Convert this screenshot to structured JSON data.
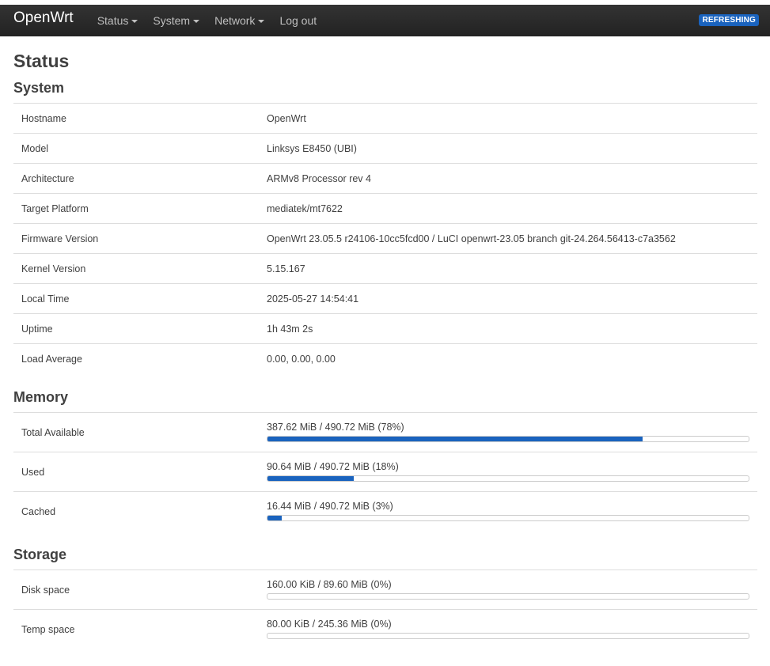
{
  "navbar": {
    "brand": "OpenWrt",
    "menu": [
      {
        "label": "Status",
        "dropdown": true
      },
      {
        "label": "System",
        "dropdown": true
      },
      {
        "label": "Network",
        "dropdown": true
      },
      {
        "label": "Log out",
        "dropdown": false
      }
    ],
    "badge": "REFRESHING"
  },
  "page_title": "Status",
  "system": {
    "title": "System",
    "rows": [
      {
        "label": "Hostname",
        "value": "OpenWrt"
      },
      {
        "label": "Model",
        "value": "Linksys E8450 (UBI)"
      },
      {
        "label": "Architecture",
        "value": "ARMv8 Processor rev 4"
      },
      {
        "label": "Target Platform",
        "value": "mediatek/mt7622"
      },
      {
        "label": "Firmware Version",
        "value": "OpenWrt 23.05.5 r24106-10cc5fcd00 / LuCI openwrt-23.05 branch git-24.264.56413-c7a3562"
      },
      {
        "label": "Kernel Version",
        "value": "5.15.167"
      },
      {
        "label": "Local Time",
        "value": "2025-05-27 14:54:41"
      },
      {
        "label": "Uptime",
        "value": "1h 43m 2s"
      },
      {
        "label": "Load Average",
        "value": "0.00, 0.00, 0.00"
      }
    ]
  },
  "memory": {
    "title": "Memory",
    "rows": [
      {
        "label": "Total Available",
        "text": "387.62 MiB / 490.72 MiB (78%)",
        "percent": 78
      },
      {
        "label": "Used",
        "text": "90.64 MiB / 490.72 MiB (18%)",
        "percent": 18
      },
      {
        "label": "Cached",
        "text": "16.44 MiB / 490.72 MiB (3%)",
        "percent": 3
      }
    ]
  },
  "storage": {
    "title": "Storage",
    "rows": [
      {
        "label": "Disk space",
        "text": "160.00 KiB / 89.60 MiB (0%)",
        "percent": 0
      },
      {
        "label": "Temp space",
        "text": "80.00 KiB / 245.36 MiB (0%)",
        "percent": 0
      }
    ]
  },
  "colors": {
    "navbar_bg": "#222222",
    "accent": "#1a63be"
  }
}
